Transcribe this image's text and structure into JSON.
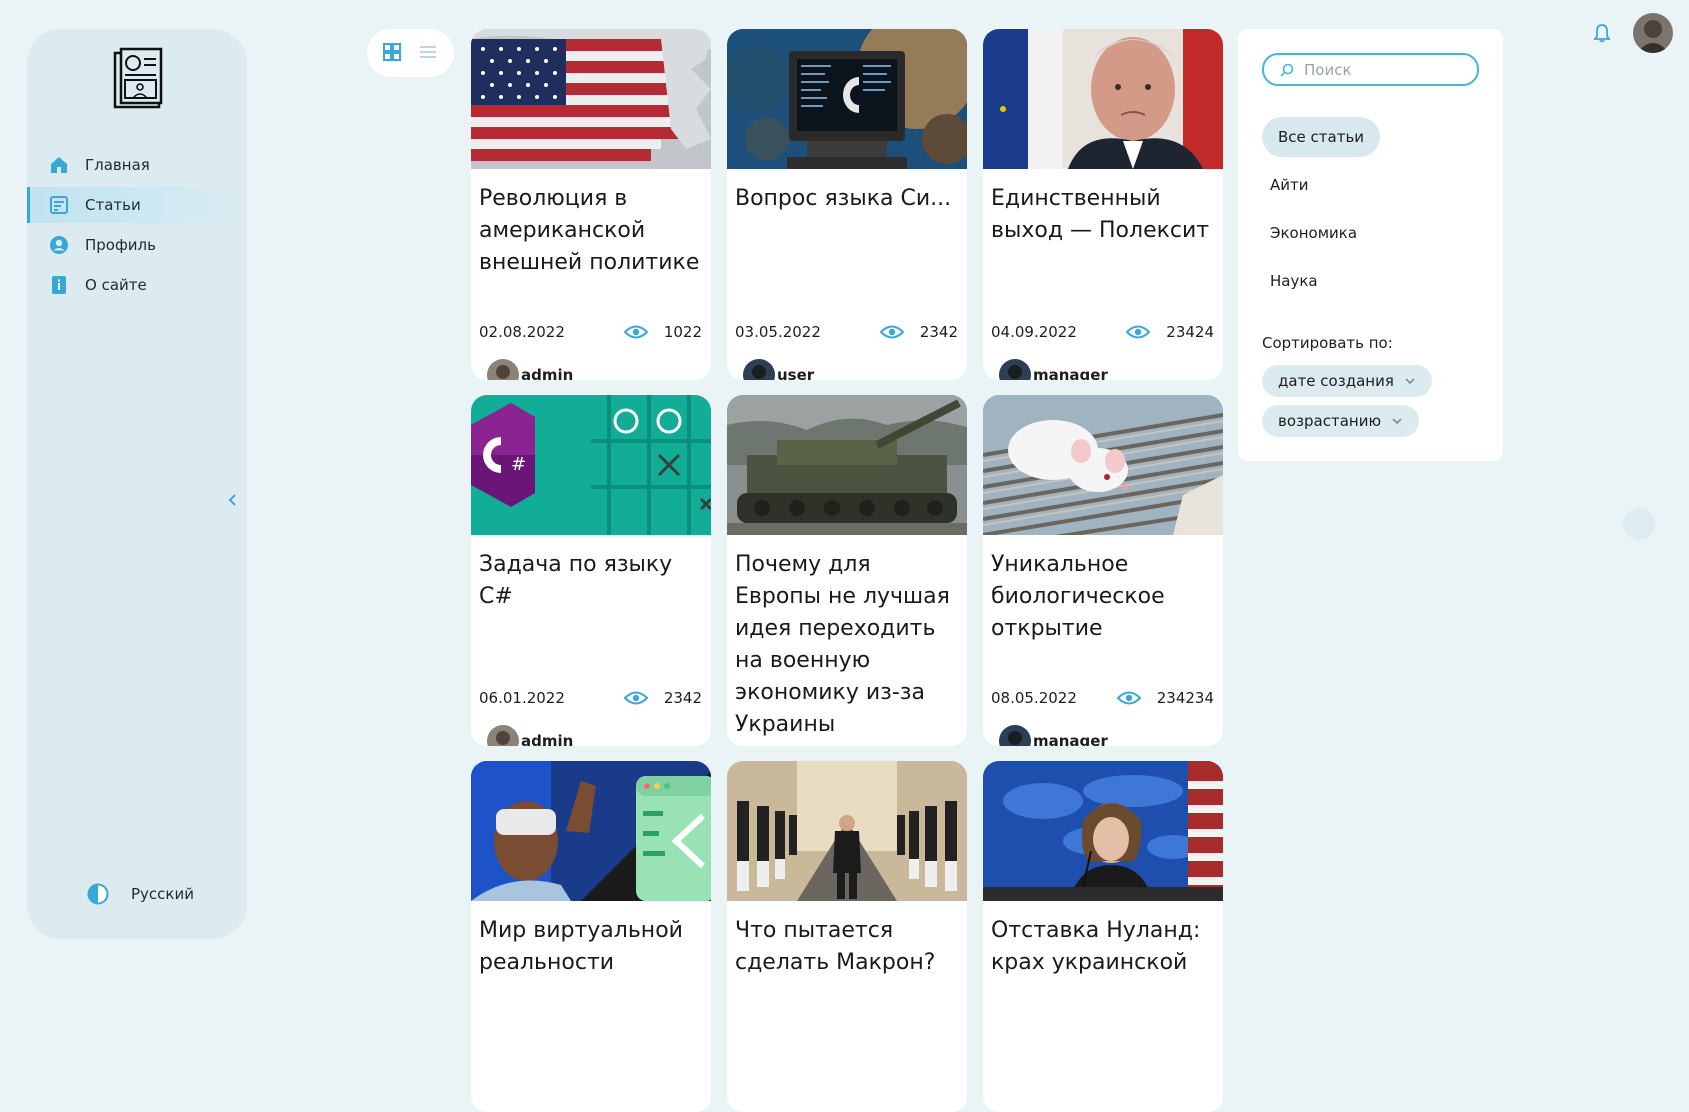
{
  "sidebar": {
    "logo_icon": "newspaper-icon",
    "items": [
      {
        "label": "Главная",
        "icon": "home-icon"
      },
      {
        "label": "Статьи",
        "icon": "articles-icon",
        "active": true
      },
      {
        "label": "Профиль",
        "icon": "profile-icon"
      },
      {
        "label": "О сайте",
        "icon": "info-icon"
      }
    ],
    "collapse_icon": "chevron-left-icon",
    "theme_icon": "theme-toggle-icon",
    "language": "Русский"
  },
  "view_toggle": {
    "grid_icon": "grid-view-icon",
    "list_icon": "list-view-icon",
    "active": "grid"
  },
  "articles": [
    {
      "title": "Революция в американской внешней политике",
      "date": "02.08.2022",
      "views": "1022",
      "author": "admin"
    },
    {
      "title": "Вопрос языка Си...",
      "date": "03.05.2022",
      "views": "2342",
      "author": "user"
    },
    {
      "title": "Единственный выход — Полексит",
      "date": "04.09.2022",
      "views": "23424",
      "author": "manager"
    },
    {
      "title": "Задача по языку C#",
      "date": "06.01.2022",
      "views": "2342",
      "author": "admin"
    },
    {
      "title": "Почему для Европы не лучшая идея переходить на военную экономику из-за Украины",
      "date": "",
      "views": "",
      "author": ""
    },
    {
      "title": "Уникальное биологическое открытие",
      "date": "08.05.2022",
      "views": "234234",
      "author": "manager"
    },
    {
      "title": "Мир виртуальной реальности",
      "date": "",
      "views": "",
      "author": ""
    },
    {
      "title": "Что пытается сделать Макрон?",
      "date": "",
      "views": "",
      "author": ""
    },
    {
      "title": "Отставка Нуланд: крах украинской",
      "date": "",
      "views": "",
      "author": ""
    }
  ],
  "filters": {
    "search_placeholder": "Поиск",
    "tabs": [
      "Все статьи",
      "Айти",
      "Экономика",
      "Наука"
    ],
    "active_tab": "Все статьи",
    "sort_label": "Сортировать по:",
    "sort_field": "дате создания",
    "sort_order": "возрастанию"
  },
  "header": {
    "bell_icon": "bell-icon",
    "avatar": "user-avatar"
  },
  "colors": {
    "accent": "#33a8d1",
    "background": "#eaf3f5",
    "sidebar": "#dcebf0"
  }
}
